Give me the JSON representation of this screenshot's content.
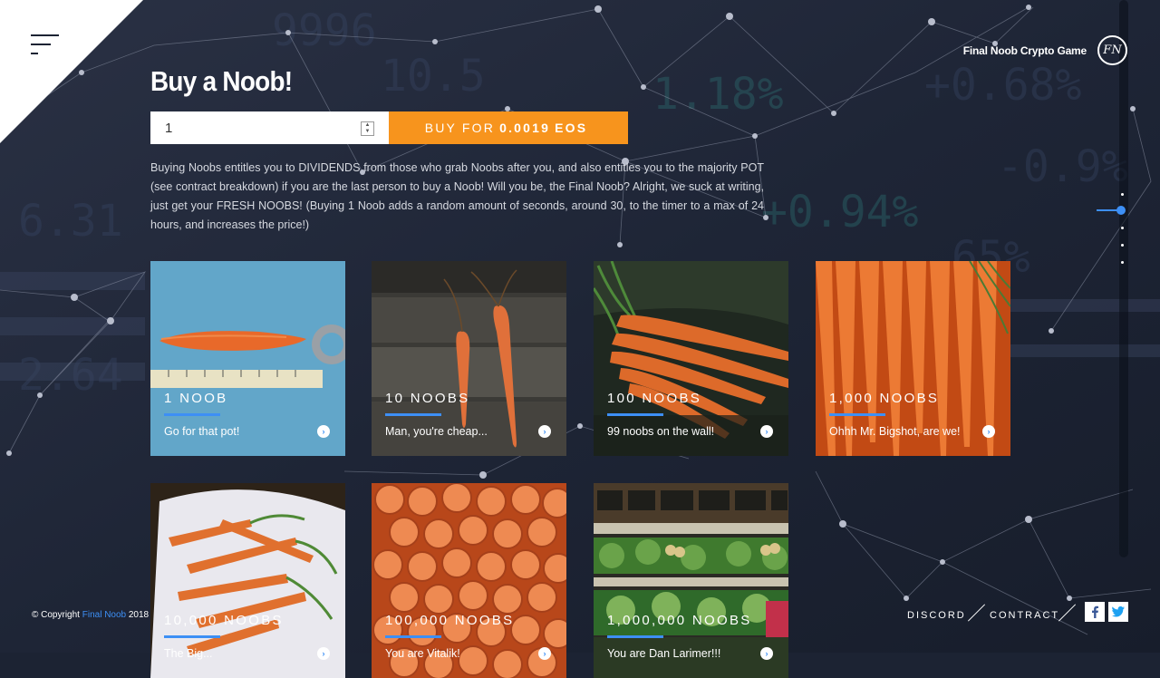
{
  "header": {
    "brand_name": "Final Noob Crypto Game",
    "logo_text": "FN"
  },
  "buy": {
    "title": "Buy a Noob!",
    "quantity": "1",
    "button_prefix": "BUY FOR",
    "button_amount": "0.0019",
    "button_currency": "EOS",
    "description": "Buying Noobs entitles you to DIVIDENDS from those who grab Noobs after you, and also entitles you to the majority POT (see contract breakdown) if you are the last person to buy a Noob! Will you be, the Final Noob? Alright, we suck at writing, just get your FRESH NOOBS! (Buying 1 Noob adds a random amount of seconds, around 30, to the timer to a max of 24 hours, and increases the price!)"
  },
  "packages": [
    {
      "title": "1 NOOB",
      "subtitle": "Go for that pot!"
    },
    {
      "title": "10 NOOBS",
      "subtitle": "Man, you're cheap..."
    },
    {
      "title": "100 NOOBS",
      "subtitle": "99 noobs on the wall!"
    },
    {
      "title": "1,000 NOOBS",
      "subtitle": "Ohhh Mr. Bigshot, are we!"
    },
    {
      "title": "10,000 NOOBS",
      "subtitle": "The Big..."
    },
    {
      "title": "100,000 NOOBS",
      "subtitle": "You are Vitalik!"
    },
    {
      "title": "1,000,000 NOOBS",
      "subtitle": "You are Dan Larimer!!!"
    }
  ],
  "footer": {
    "copyright_prefix": "© Copyright",
    "copyright_link": "Final Noob",
    "copyright_year": "2018",
    "discord_label": "DISCORD",
    "contract_label": "CONTRACT",
    "facebook_icon": "facebook-icon",
    "twitter_icon": "twitter-icon"
  },
  "colors": {
    "accent": "#3d8ff5",
    "buy_button": "#f7941d",
    "background": "#1c2333"
  }
}
